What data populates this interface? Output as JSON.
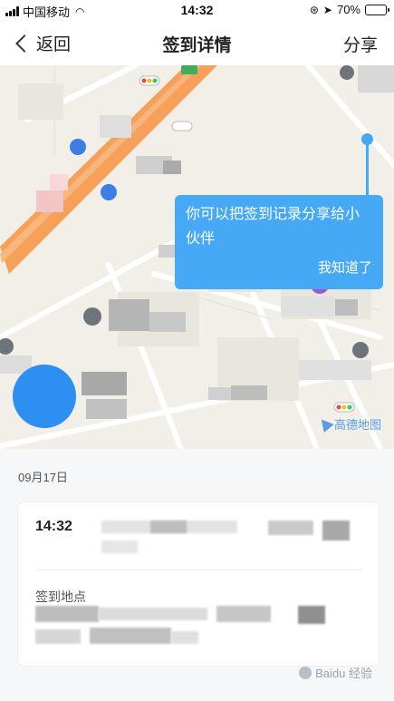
{
  "status_bar": {
    "carrier": "中国移动",
    "time": "14:32",
    "battery": "70%",
    "battery_level": 0.7
  },
  "nav": {
    "back_label": "返回",
    "title": "签到详情",
    "share_label": "分享"
  },
  "map": {
    "tooltip_text": "你可以把签到记录分享给小伙伴",
    "tooltip_button": "我知道了",
    "provider_logo": "高德地图"
  },
  "record": {
    "date": "09月17日",
    "time": "14:32",
    "location_label": "签到地点"
  },
  "watermark": "Baidu 经验",
  "colors": {
    "accent_blue": "#46a9f5",
    "locate_blue": "#2e8ff3",
    "road_orange": "#f6a05a",
    "map_background": "#f1efe8"
  }
}
